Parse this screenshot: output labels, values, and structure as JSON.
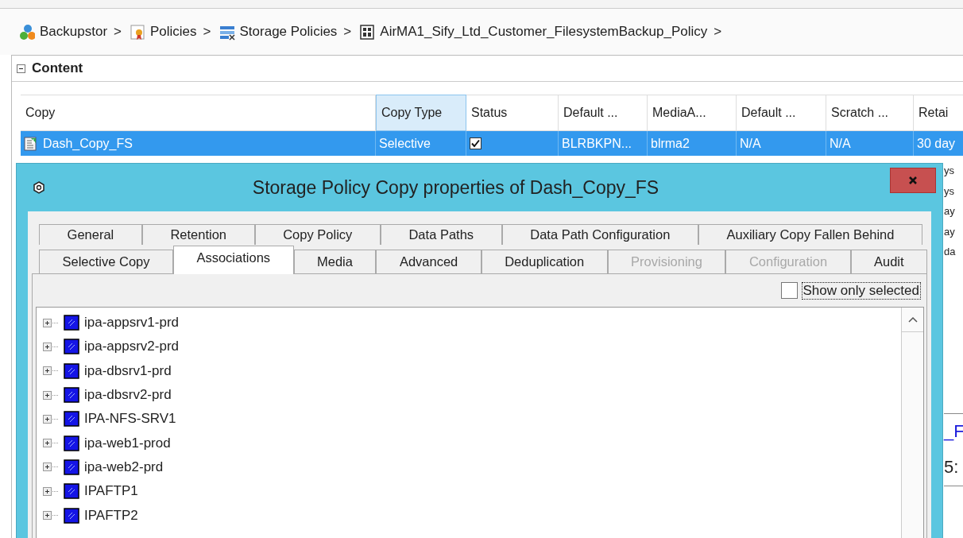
{
  "breadcrumb": [
    {
      "label": "Backupstor",
      "kind": "server-group",
      "separator": ">"
    },
    {
      "label": "Policies",
      "kind": "certificate",
      "separator": ">"
    },
    {
      "label": "Storage Policies",
      "kind": "storage",
      "separator": ">"
    },
    {
      "label": "AirMA1_Sify_Ltd_Customer_FilesystemBackup_Policy",
      "kind": "policy",
      "separator": ">"
    }
  ],
  "content": {
    "title": "Content",
    "expanded": true,
    "table": {
      "columns": [
        {
          "label": "Copy",
          "sorted": false
        },
        {
          "label": "Copy Type",
          "sorted": true
        },
        {
          "label": "Status",
          "sorted": false
        },
        {
          "label": "Default ...",
          "sorted": false
        },
        {
          "label": "MediaA...",
          "sorted": false
        },
        {
          "label": "Default ...",
          "sorted": false
        },
        {
          "label": "Scratch ...",
          "sorted": false
        },
        {
          "label": "Retai",
          "sorted": false
        }
      ],
      "rows": [
        {
          "selected": true,
          "cells": [
            {
              "kind": "named",
              "text": "Dash_Copy_FS"
            },
            {
              "kind": "text",
              "text": "Selective"
            },
            {
              "kind": "checkbox",
              "checked": true
            },
            {
              "kind": "text",
              "text": "BLRBKPN..."
            },
            {
              "kind": "text",
              "text": "blrma2"
            },
            {
              "kind": "text",
              "text": "N/A"
            },
            {
              "kind": "text",
              "text": "N/A"
            },
            {
              "kind": "text",
              "text": "30 day"
            }
          ]
        }
      ]
    },
    "side_fragments": [
      {
        "text": "ys",
        "kind": "plain"
      },
      {
        "text": "ys",
        "kind": "plain"
      },
      {
        "text": "ay",
        "kind": "plain"
      },
      {
        "text": "ay",
        "kind": "plain"
      },
      {
        "text": "da",
        "kind": "plain"
      },
      {
        "text": "_F",
        "kind": "link"
      },
      {
        "text": "5:",
        "kind": "large"
      }
    ]
  },
  "dialog": {
    "title": "Storage Policy Copy properties of Dash_Copy_FS",
    "tab_rows": [
      [
        {
          "label": "General",
          "selected": false,
          "disabled": false
        },
        {
          "label": "Retention",
          "selected": false,
          "disabled": false
        },
        {
          "label": "Copy Policy",
          "selected": false,
          "disabled": false
        },
        {
          "label": "Data Paths",
          "selected": false,
          "disabled": false
        },
        {
          "label": "Data Path Configuration",
          "selected": false,
          "disabled": false
        },
        {
          "label": "Auxiliary Copy Fallen Behind",
          "selected": false,
          "disabled": false
        }
      ],
      [
        {
          "label": "Selective Copy",
          "selected": false,
          "disabled": false
        },
        {
          "label": "Associations",
          "selected": true,
          "disabled": false
        },
        {
          "label": "Media",
          "selected": false,
          "disabled": false
        },
        {
          "label": "Advanced",
          "selected": false,
          "disabled": false
        },
        {
          "label": "Deduplication",
          "selected": false,
          "disabled": false
        },
        {
          "label": "Provisioning",
          "selected": false,
          "disabled": true
        },
        {
          "label": "Configuration",
          "selected": false,
          "disabled": true
        },
        {
          "label": "Audit",
          "selected": false,
          "disabled": false
        }
      ]
    ],
    "show_only_selected": {
      "label": "Show only selected",
      "checked": false,
      "focused": true
    },
    "tree": [
      {
        "label": "ipa-appsrv1-prd",
        "expanded": false
      },
      {
        "label": "ipa-appsrv2-prd",
        "expanded": false
      },
      {
        "label": "ipa-dbsrv1-prd",
        "expanded": false
      },
      {
        "label": "ipa-dbsrv2-prd",
        "expanded": false
      },
      {
        "label": "IPA-NFS-SRV1",
        "expanded": false
      },
      {
        "label": "ipa-web1-prod",
        "expanded": false
      },
      {
        "label": "ipa-web2-prd",
        "expanded": false
      },
      {
        "label": "IPAFTP1",
        "expanded": false
      },
      {
        "label": "IPAFTP2",
        "expanded": false
      }
    ]
  }
}
